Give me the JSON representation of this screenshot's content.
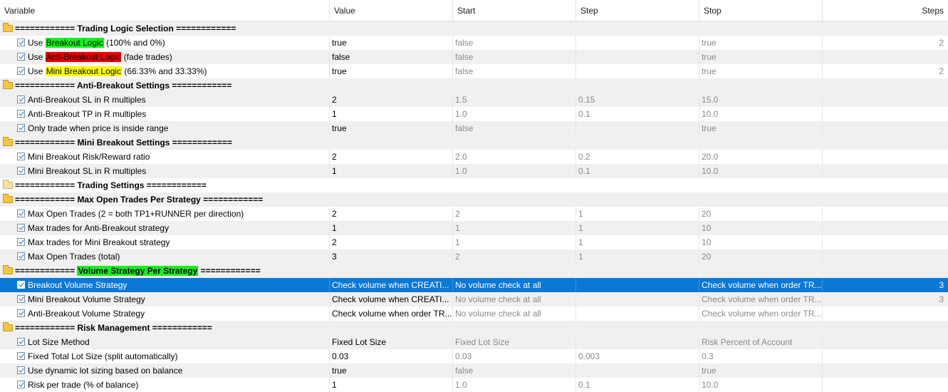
{
  "columns": [
    "Variable",
    "Value",
    "Start",
    "Step",
    "Stop",
    "Steps"
  ],
  "rows": [
    {
      "type": "group",
      "pre": "============ ",
      "hl": "",
      "hlColor": "",
      "label": "Trading Logic Selection",
      "post": " ============"
    },
    {
      "type": "param",
      "pre": "Use ",
      "hl": "Breakout Logic",
      "hlColor": "green",
      "post": " (100% and 0%)",
      "value": "true",
      "start": "false",
      "step": "",
      "stop": "true",
      "steps": "2"
    },
    {
      "type": "param",
      "pre": "Use ",
      "hl": "Anti-Breakout Logic",
      "hlColor": "red",
      "post": " (fade trades)",
      "value": "false",
      "start": "false",
      "step": "",
      "stop": "true",
      "steps": ""
    },
    {
      "type": "param",
      "pre": "Use ",
      "hl": "Mini Breakout Logic",
      "hlColor": "yellow",
      "post": " (66.33% and 33.33%)",
      "value": "true",
      "start": "false",
      "step": "",
      "stop": "true",
      "steps": "2"
    },
    {
      "type": "group",
      "pre": "============ ",
      "hl": "",
      "hlColor": "",
      "label": "Anti-Breakout Settings",
      "post": " ============"
    },
    {
      "type": "param",
      "pre": "Anti-Breakout SL in R multiples",
      "hl": "",
      "hlColor": "",
      "post": "",
      "value": "2",
      "start": "1.5",
      "step": "0.15",
      "stop": "15.0",
      "steps": ""
    },
    {
      "type": "param",
      "pre": "Anti-Breakout TP in R multiples",
      "hl": "",
      "hlColor": "",
      "post": "",
      "value": "1",
      "start": "1.0",
      "step": "0.1",
      "stop": "10.0",
      "steps": ""
    },
    {
      "type": "param",
      "pre": "Only trade when price is inside range",
      "hl": "",
      "hlColor": "",
      "post": "",
      "value": "true",
      "start": "false",
      "step": "",
      "stop": "true",
      "steps": ""
    },
    {
      "type": "group",
      "pre": "============ ",
      "hl": "",
      "hlColor": "",
      "label": "Mini Breakout Settings",
      "post": " ============"
    },
    {
      "type": "param",
      "pre": "Mini Breakout Risk/Reward ratio",
      "hl": "",
      "hlColor": "",
      "post": "",
      "value": "2",
      "start": "2.0",
      "step": "0.2",
      "stop": "20.0",
      "steps": ""
    },
    {
      "type": "param",
      "pre": "Mini Breakout SL in R multiples",
      "hl": "",
      "hlColor": "",
      "post": "",
      "value": "1",
      "start": "1.0",
      "step": "0.1",
      "stop": "10.0",
      "steps": ""
    },
    {
      "type": "group",
      "closed": true,
      "pre": "============ ",
      "hl": "",
      "hlColor": "",
      "label": "Trading Settings",
      "post": " ============"
    },
    {
      "type": "group",
      "pre": "============ ",
      "hl": "",
      "hlColor": "",
      "label": "Max Open Trades Per Strategy",
      "post": " ============"
    },
    {
      "type": "param",
      "pre": "Max Open Trades (2 = both TP1+RUNNER per direction)",
      "hl": "",
      "hlColor": "",
      "post": "",
      "value": "2",
      "start": "2",
      "step": "1",
      "stop": "20",
      "steps": ""
    },
    {
      "type": "param",
      "pre": "Max trades for Anti-Breakout strategy",
      "hl": "",
      "hlColor": "",
      "post": "",
      "value": "1",
      "start": "1",
      "step": "1",
      "stop": "10",
      "steps": ""
    },
    {
      "type": "param",
      "pre": "Max trades for Mini Breakout strategy",
      "hl": "",
      "hlColor": "",
      "post": "",
      "value": "2",
      "start": "1",
      "step": "1",
      "stop": "10",
      "steps": ""
    },
    {
      "type": "param",
      "pre": "Max Open Trades (total)",
      "hl": "",
      "hlColor": "",
      "post": "",
      "value": "3",
      "start": "2",
      "step": "1",
      "stop": "20",
      "steps": ""
    },
    {
      "type": "group",
      "pre": "============ ",
      "hl": "Volume Strategy Per Strategy",
      "hlColor": "green",
      "label": "",
      "post": " ============"
    },
    {
      "type": "param",
      "selected": true,
      "pre": "Breakout Volume Strategy",
      "hl": "",
      "hlColor": "",
      "post": "",
      "value": "Check volume when CREATI...",
      "start": "No volume check at all",
      "step": "",
      "stop": "Check volume when order TR...",
      "steps": "3"
    },
    {
      "type": "param",
      "pre": "Mini Breakout Volume Strategy",
      "hl": "",
      "hlColor": "",
      "post": "",
      "value": "Check volume when CREATI...",
      "start": "No volume check at all",
      "step": "",
      "stop": "Check volume when order TR...",
      "steps": "3"
    },
    {
      "type": "param",
      "pre": "Anti-Breakout Volume Strategy",
      "hl": "",
      "hlColor": "",
      "post": "",
      "value": "Check volume when order TR...",
      "start": "No volume check at all",
      "step": "",
      "stop": "Check volume when order TR...",
      "steps": ""
    },
    {
      "type": "group",
      "pre": "============ ",
      "hl": "",
      "hlColor": "",
      "label": "Risk Management",
      "post": " ============"
    },
    {
      "type": "param",
      "pre": "Lot Size Method",
      "hl": "",
      "hlColor": "",
      "post": "",
      "value": "Fixed Lot Size",
      "start": "Fixed Lot Size",
      "step": "",
      "stop": "Risk Percent of Account",
      "steps": ""
    },
    {
      "type": "param",
      "pre": "Fixed Total Lot Size (split automatically)",
      "hl": "",
      "hlColor": "",
      "post": "",
      "value": "0.03",
      "start": "0.03",
      "step": "0.003",
      "stop": "0.3",
      "steps": ""
    },
    {
      "type": "param",
      "pre": "Use dynamic lot sizing based on balance",
      "hl": "",
      "hlColor": "",
      "post": "",
      "value": "true",
      "start": "false",
      "step": "",
      "stop": "true",
      "steps": ""
    },
    {
      "type": "param",
      "pre": "Risk per trade (% of balance)",
      "hl": "",
      "hlColor": "",
      "post": "",
      "value": "1",
      "start": "1.0",
      "step": "0.1",
      "stop": "10.0",
      "steps": ""
    }
  ],
  "colors": {
    "selected": "#0a78d7",
    "green": "#14f01e",
    "red": "#e60000",
    "yellow": "#ffff00",
    "folder": "#f5c542"
  }
}
